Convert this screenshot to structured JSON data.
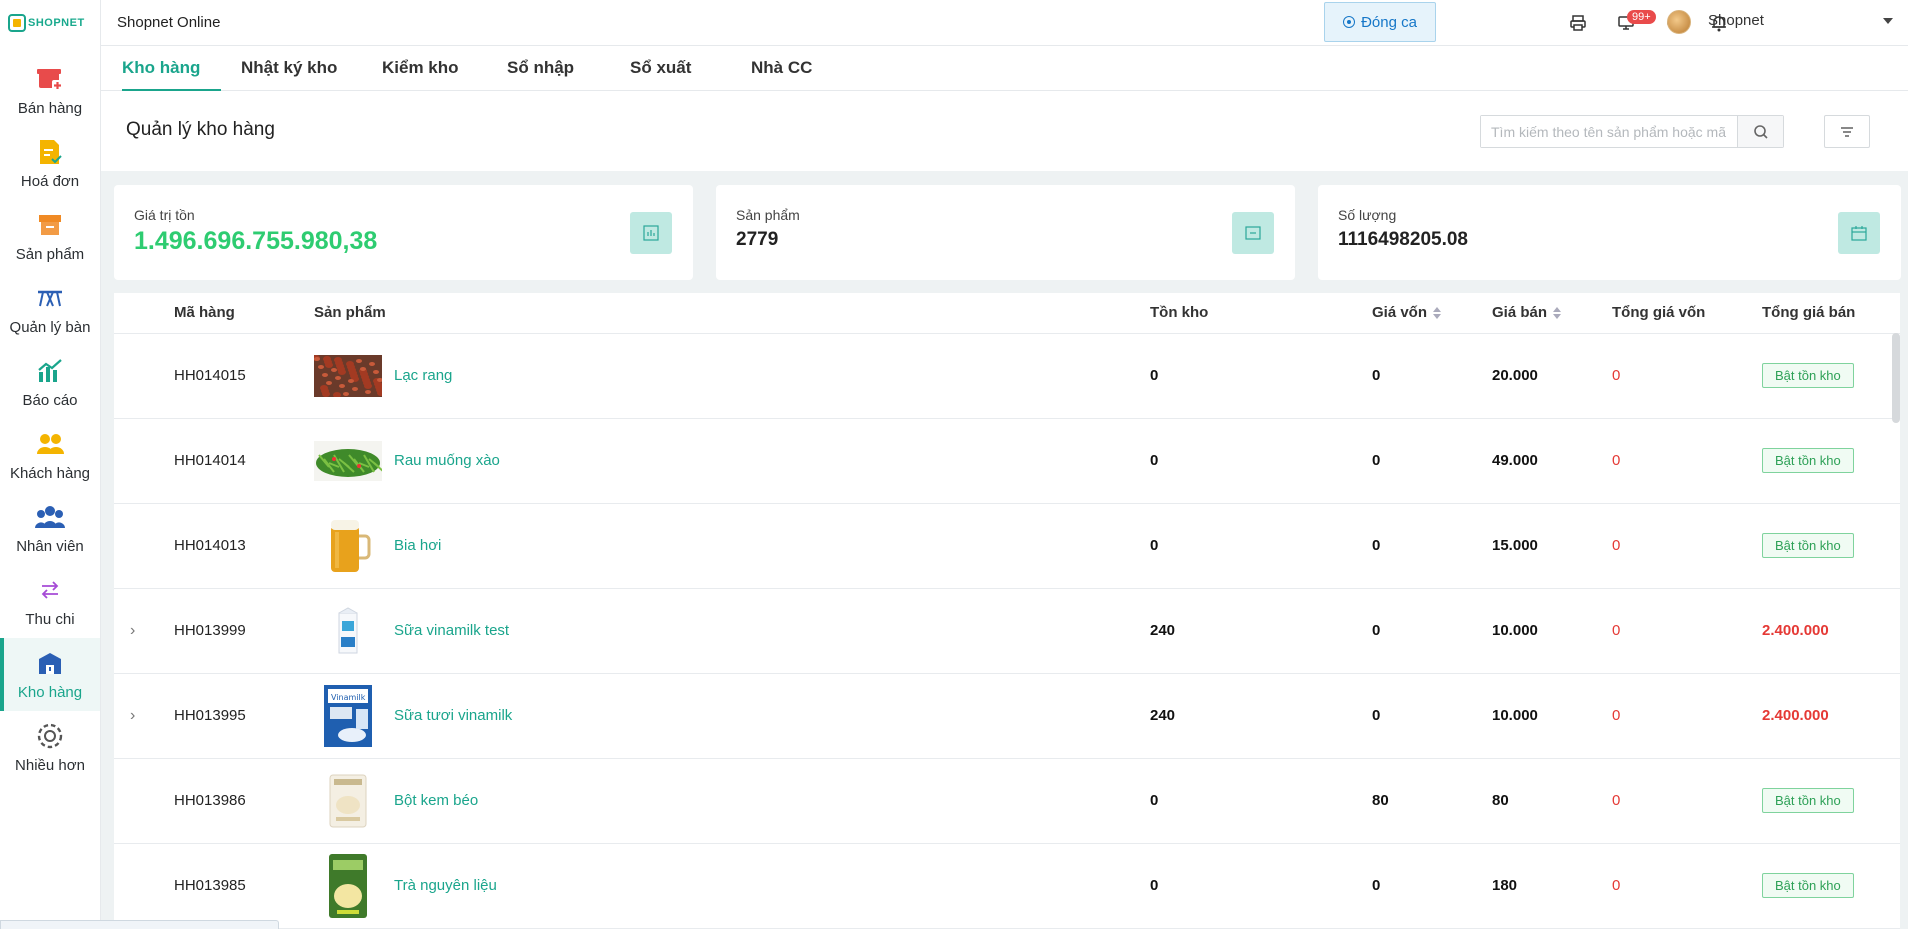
{
  "app": {
    "logo_text": "SHOPNET",
    "store_name": "Shopnet Online",
    "close_shift_label": "Đóng ca",
    "notification_count": "99+",
    "user_name": "Shopnet"
  },
  "sidebar": {
    "items": [
      {
        "label": "Bán hàng",
        "icon": "store-add-icon",
        "color": "#e84b4b"
      },
      {
        "label": "Hoá đơn",
        "icon": "invoice-icon",
        "color": "#f4b400"
      },
      {
        "label": "Sản phẩm",
        "icon": "box-icon",
        "color": "#f08a24"
      },
      {
        "label": "Quản lý bàn",
        "icon": "table-icon",
        "color": "#2b5fb4"
      },
      {
        "label": "Báo cáo",
        "icon": "chart-icon",
        "color": "#1aa58c"
      },
      {
        "label": "Khách hàng",
        "icon": "customers-icon",
        "color": "#f4b400"
      },
      {
        "label": "Nhân viên",
        "icon": "staff-icon",
        "color": "#2b5fb4"
      },
      {
        "label": "Thu chi",
        "icon": "transfer-icon",
        "color": "#a64bd6"
      },
      {
        "label": "Kho hàng",
        "icon": "warehouse-icon",
        "color": "#2b5fb4"
      },
      {
        "label": "Nhiều hơn",
        "icon": "gear-icon",
        "color": "#555"
      }
    ],
    "active": "Kho hàng"
  },
  "tabs": [
    {
      "label": "Kho hàng"
    },
    {
      "label": "Nhật ký kho"
    },
    {
      "label": "Kiểm kho"
    },
    {
      "label": "Sổ nhập"
    },
    {
      "label": "Sổ xuất"
    },
    {
      "label": "Nhà CC"
    }
  ],
  "page": {
    "title": "Quản lý kho hàng",
    "search_placeholder": "Tìm kiếm theo tên sản phẩm hoặc mã"
  },
  "stats": [
    {
      "label": "Giá trị tồn",
      "value": "1.496.696.755.980,38"
    },
    {
      "label": "Sản phẩm",
      "value": "2779"
    },
    {
      "label": "Số lượng",
      "value": "1116498205.08"
    }
  ],
  "table": {
    "columns": [
      "Mã hàng",
      "Sản phẩm",
      "Tồn kho",
      "Giá vốn",
      "Giá bán",
      "Tổng giá vốn",
      "Tổng giá bán"
    ],
    "rows": [
      {
        "code": "HH014015",
        "name": "Lạc rang",
        "stock": "0",
        "cost": "0",
        "price": "20.000",
        "total_cost": "0",
        "total_price": "Bật tồn kho",
        "expandable": false,
        "thumb": "peanuts"
      },
      {
        "code": "HH014014",
        "name": "Rau muống xào",
        "stock": "0",
        "cost": "0",
        "price": "49.000",
        "total_cost": "0",
        "total_price": "Bật tồn kho",
        "expandable": false,
        "thumb": "greens"
      },
      {
        "code": "HH014013",
        "name": "Bia hơi",
        "stock": "0",
        "cost": "0",
        "price": "15.000",
        "total_cost": "0",
        "total_price": "Bật tồn kho",
        "expandable": false,
        "thumb": "beer"
      },
      {
        "code": "HH013999",
        "name": "Sữa vinamilk test",
        "stock": "240",
        "cost": "0",
        "price": "10.000",
        "total_cost": "0",
        "total_price": "2.400.000",
        "expandable": true,
        "thumb": "milkbox"
      },
      {
        "code": "HH013995",
        "name": "Sữa tươi vinamilk",
        "stock": "240",
        "cost": "0",
        "price": "10.000",
        "total_cost": "0",
        "total_price": "2.400.000",
        "expandable": true,
        "thumb": "milkpack"
      },
      {
        "code": "HH013986",
        "name": "Bột kem béo",
        "stock": "0",
        "cost": "80",
        "price": "80",
        "total_cost": "0",
        "total_price": "Bật tồn kho",
        "expandable": false,
        "thumb": "powderbag"
      },
      {
        "code": "HH013985",
        "name": "Trà nguyên liệu",
        "stock": "0",
        "cost": "0",
        "price": "180",
        "total_cost": "0",
        "total_price": "Bật tồn kho",
        "expandable": false,
        "thumb": "teabag"
      }
    ]
  }
}
